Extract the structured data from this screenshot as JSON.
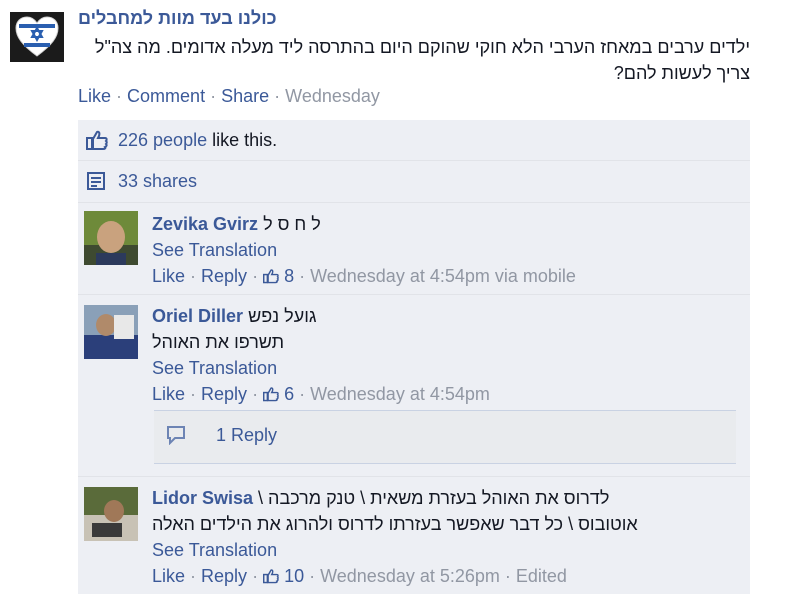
{
  "post": {
    "author": "כולנו בעד מוות למחבלים",
    "text": "ילדים ערבים במאחז הערבי הלא חוקי שהוקם היום בהתרסה ליד מעלה אדומים. מה צה\"ל צריך לעשות להם?",
    "actions": {
      "like": "Like",
      "comment": "Comment",
      "share": "Share",
      "sep": "·",
      "time": "Wednesday"
    }
  },
  "feedback": {
    "likes_count": "226 people",
    "likes_suffix": " like this.",
    "shares": "33 shares"
  },
  "comments": [
    {
      "name": "Zevika Gvirz",
      "text": "ל ח ס ל",
      "translate": "See Translation",
      "like": "Like",
      "reply": "Reply",
      "likes": "8",
      "time": "Wednesday at 4:54pm",
      "via": "via mobile"
    },
    {
      "name": "Oriel Diller",
      "text": "גועל נפש",
      "text2": "תשרפו את האוהל",
      "translate": "See Translation",
      "like": "Like",
      "reply": "Reply",
      "likes": "6",
      "time": "Wednesday at 4:54pm",
      "replies": "1 Reply"
    },
    {
      "name": "Lidor Swisa",
      "text": "לדרוס את האוהל בעזרת משאית \\ טנק מרכבה \\",
      "text2": "אוטובוס \\ כל דבר שאפשר בעזרתו לדרוס ולהרוג את הילדים האלה",
      "translate": "See Translation",
      "like": "Like",
      "reply": "Reply",
      "likes": "10",
      "time": "Wednesday at 5:26pm",
      "edited": "Edited"
    }
  ],
  "sep": " · ",
  "colors": {
    "link": "#3b5998",
    "muted": "#9197a3",
    "panel": "#edeff4"
  }
}
